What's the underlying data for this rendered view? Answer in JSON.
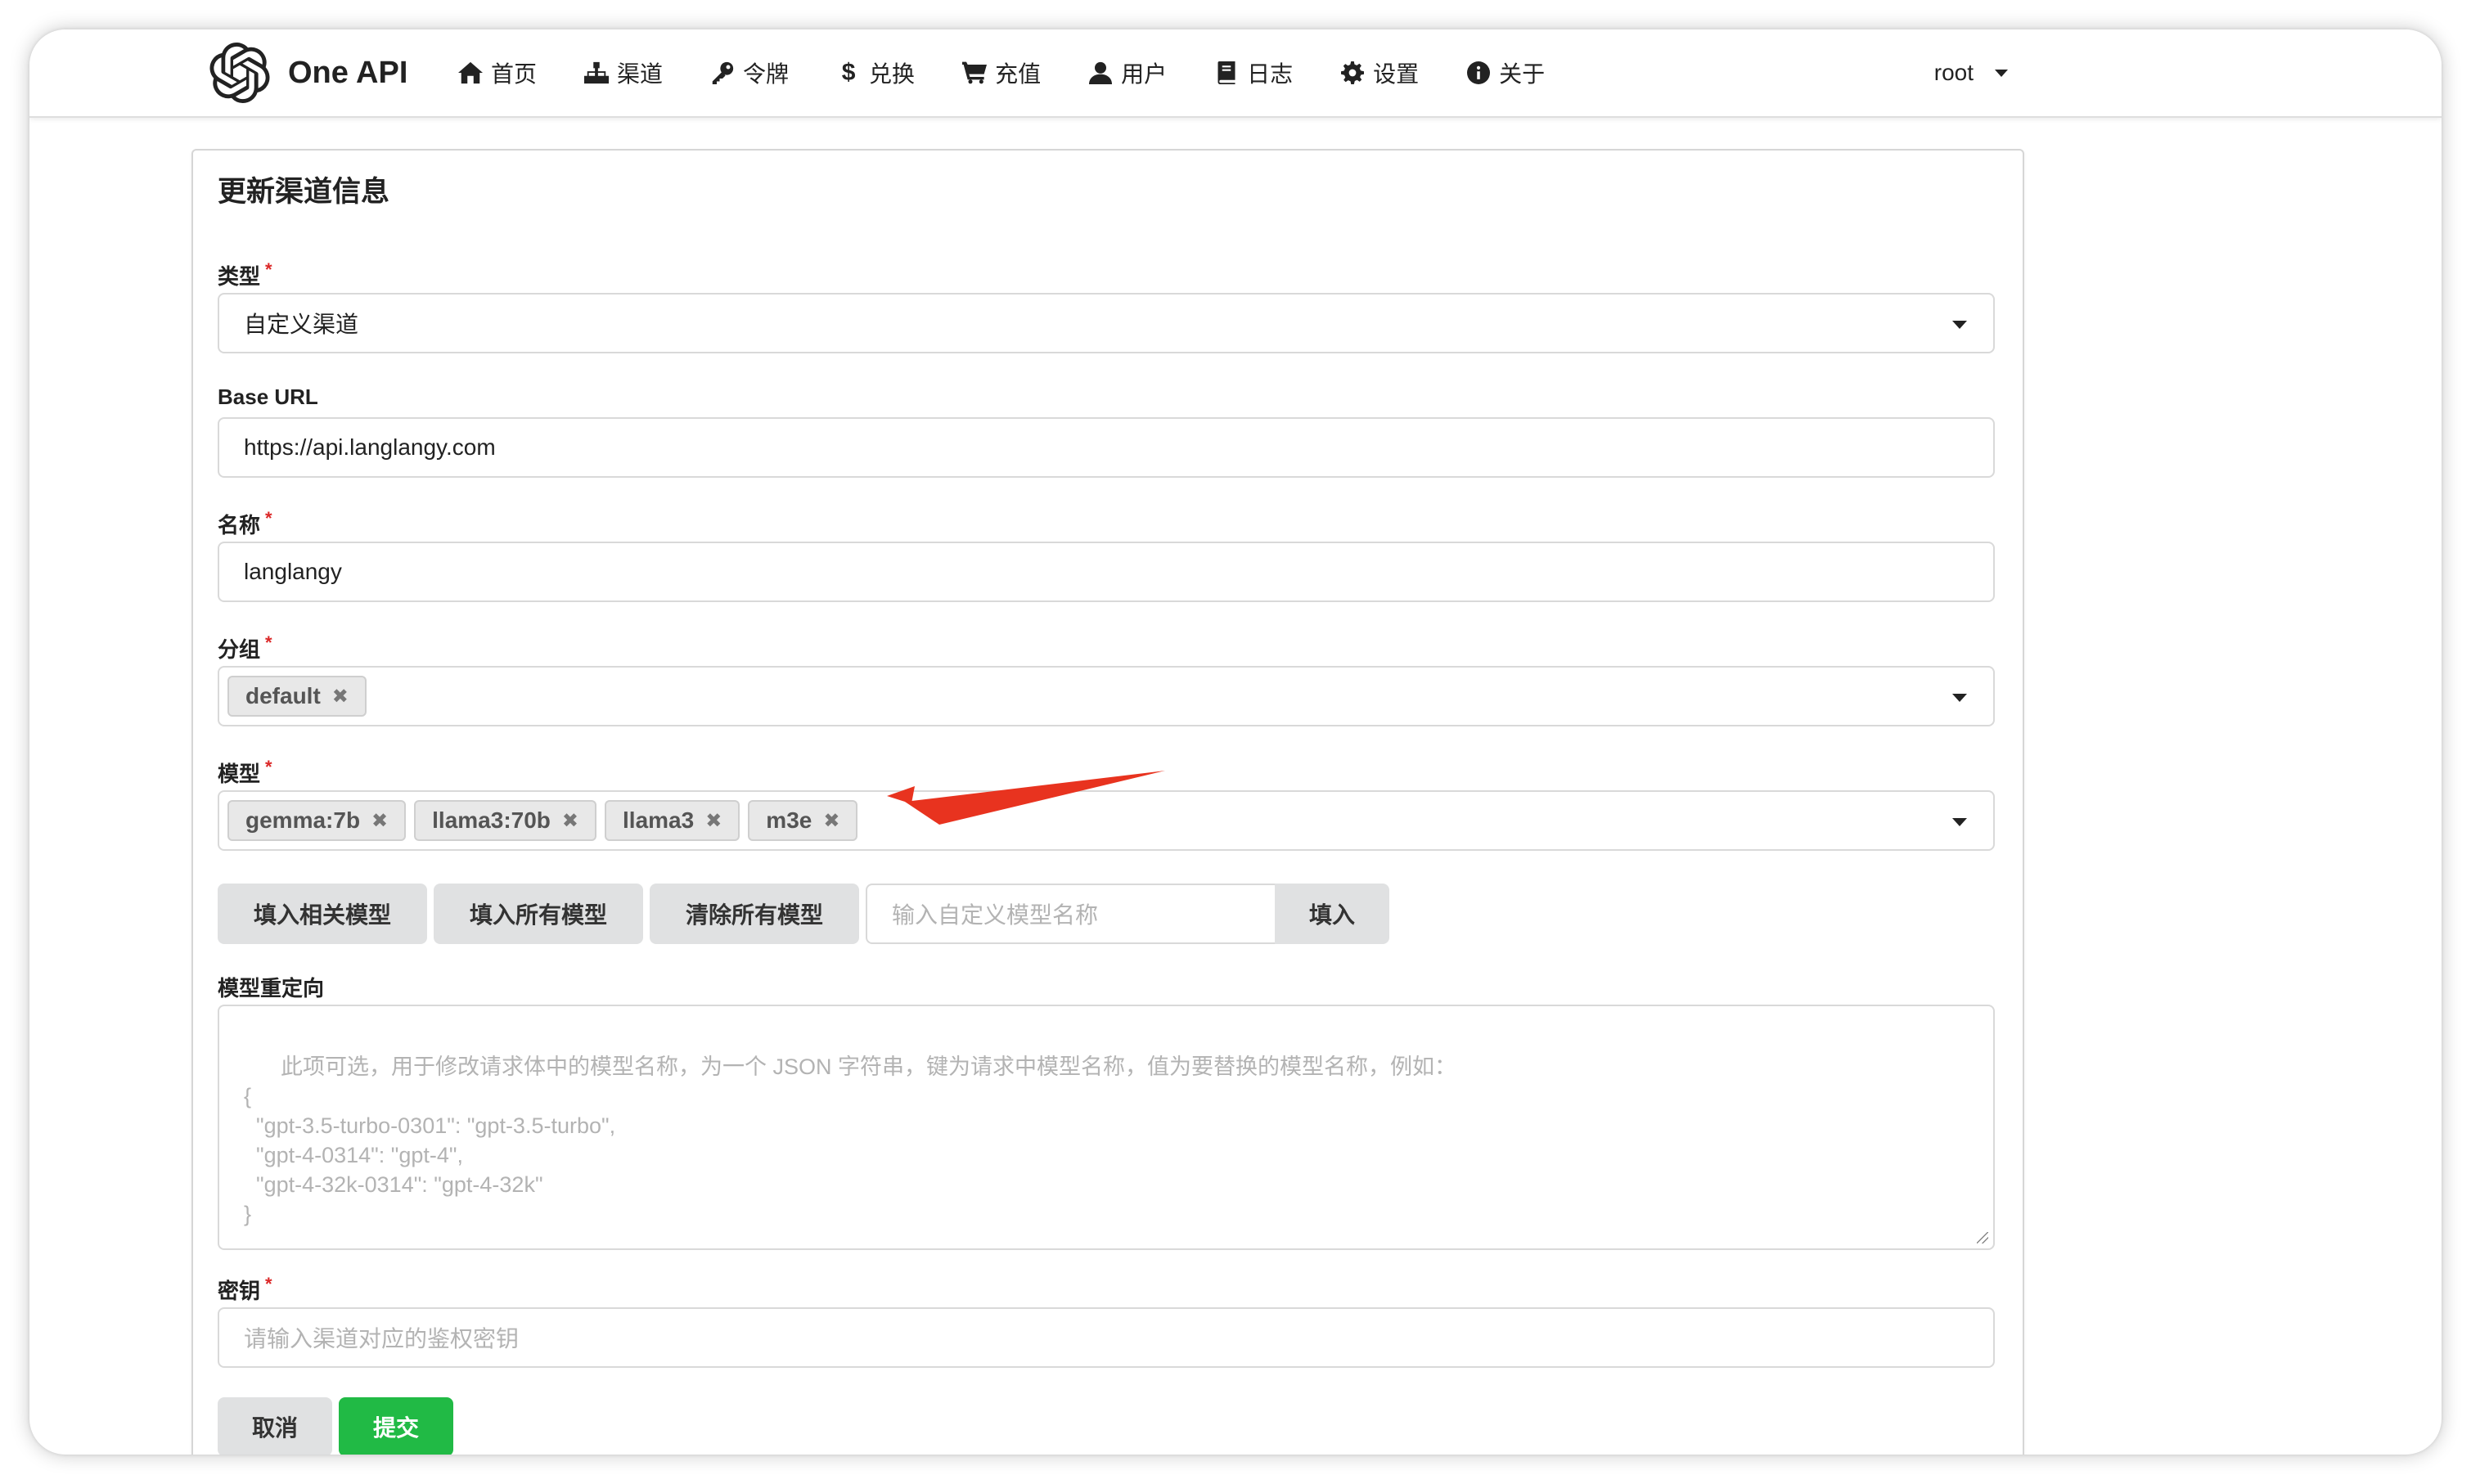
{
  "app": {
    "name": "One API",
    "logo_icon": "openai-logo-icon"
  },
  "nav": {
    "items": [
      {
        "label": "首页",
        "icon": "home-icon"
      },
      {
        "label": "渠道",
        "icon": "sitemap-icon"
      },
      {
        "label": "令牌",
        "icon": "key-icon"
      },
      {
        "label": "兑换",
        "icon": "dollar-icon"
      },
      {
        "label": "充值",
        "icon": "cart-icon"
      },
      {
        "label": "用户",
        "icon": "user-icon"
      },
      {
        "label": "日志",
        "icon": "book-icon"
      },
      {
        "label": "设置",
        "icon": "gear-icon"
      },
      {
        "label": "关于",
        "icon": "info-icon"
      }
    ],
    "user": "root"
  },
  "form": {
    "title": "更新渠道信息",
    "type": {
      "label": "类型",
      "value": "自定义渠道"
    },
    "base_url": {
      "label": "Base URL",
      "value": "https://api.langlangy.com"
    },
    "name": {
      "label": "名称",
      "value": "langlangy"
    },
    "group": {
      "label": "分组",
      "chips": [
        "default"
      ]
    },
    "models": {
      "label": "模型",
      "chips": [
        "gemma:7b",
        "llama3:70b",
        "llama3",
        "m3e"
      ]
    },
    "model_buttons": {
      "fill_related": "填入相关模型",
      "fill_all": "填入所有模型",
      "clear_all": "清除所有模型",
      "custom_placeholder": "输入自定义模型名称",
      "fill": "填入"
    },
    "model_mapping": {
      "label": "模型重定向",
      "placeholder": "此项可选，用于修改请求体中的模型名称，为一个 JSON 字符串，键为请求中模型名称，值为要替换的模型名称，例如：\n{\n  \"gpt-3.5-turbo-0301\": \"gpt-3.5-turbo\",\n  \"gpt-4-0314\": \"gpt-4\",\n  \"gpt-4-32k-0314\": \"gpt-4-32k\"\n}"
    },
    "key": {
      "label": "密钥",
      "placeholder": "请输入渠道对应的鉴权密钥"
    },
    "cancel": "取消",
    "submit": "提交"
  },
  "colors": {
    "submit": "#21ba45",
    "required": "#db2828",
    "annotation_arrow": "#e8331f"
  }
}
